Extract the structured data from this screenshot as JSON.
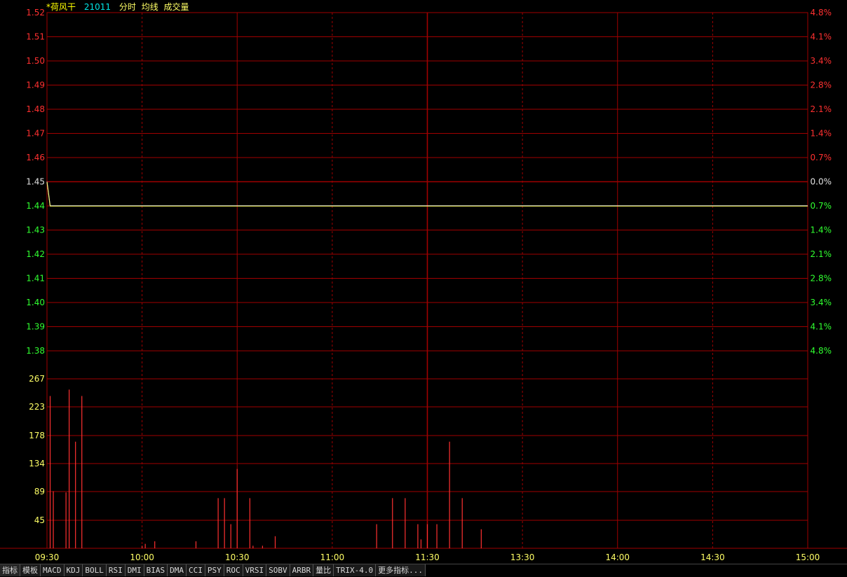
{
  "header": {
    "stock_name": "*荷风干",
    "stock_code": "21011",
    "legend_items": [
      "分时",
      "均线",
      "成交量"
    ],
    "colors": {
      "name": "#ffff00",
      "code": "#00e5e5",
      "legend": "#ffff66"
    }
  },
  "price_axis": {
    "labels": [
      "1.52",
      "1.51",
      "1.50",
      "1.49",
      "1.48",
      "1.47",
      "1.46",
      "1.45",
      "1.44",
      "1.43",
      "1.42",
      "1.41",
      "1.40",
      "1.39",
      "1.38"
    ],
    "colors": [
      "#ff3030",
      "#ff3030",
      "#ff3030",
      "#ff3030",
      "#ff3030",
      "#ff3030",
      "#ff3030",
      "#e0e0e0",
      "#30ff30",
      "#30ff30",
      "#30ff30",
      "#30ff30",
      "#30ff30",
      "#30ff30",
      "#30ff30"
    ]
  },
  "percent_axis": {
    "labels": [
      "4.8%",
      "4.1%",
      "3.4%",
      "2.8%",
      "2.1%",
      "1.4%",
      "0.7%",
      "0.0%",
      "0.7%",
      "1.4%",
      "2.1%",
      "2.8%",
      "3.4%",
      "4.1%",
      "4.8%"
    ],
    "colors": [
      "#ff3030",
      "#ff3030",
      "#ff3030",
      "#ff3030",
      "#ff3030",
      "#ff3030",
      "#ff3030",
      "#e0e0e0",
      "#30ff30",
      "#30ff30",
      "#30ff30",
      "#30ff30",
      "#30ff30",
      "#30ff30",
      "#30ff30"
    ]
  },
  "volume_axis": {
    "labels": [
      "267",
      "223",
      "178",
      "134",
      "89",
      "45"
    ],
    "color": "#ffff66"
  },
  "time_axis": {
    "labels": [
      "09:30",
      "10:00",
      "10:30",
      "11:00",
      "11:30",
      "13:30",
      "14:00",
      "14:30",
      "15:00"
    ],
    "color": "#ffff66"
  },
  "chart_data": {
    "type": "line",
    "title": "*荷风干 21011",
    "price_range": [
      1.38,
      1.52
    ],
    "volume_range": [
      0,
      267
    ],
    "price_series": {
      "name": "分时",
      "x": [
        "09:30",
        "09:31",
        "15:00"
      ],
      "y": [
        1.45,
        1.44,
        1.44
      ]
    },
    "volume_bars": [
      {
        "min": 1,
        "value": 240
      },
      {
        "min": 2,
        "value": 90
      },
      {
        "min": 6,
        "value": 88
      },
      {
        "min": 7,
        "value": 250
      },
      {
        "min": 9,
        "value": 168
      },
      {
        "min": 11,
        "value": 240
      },
      {
        "min": 30,
        "value": 4
      },
      {
        "min": 31,
        "value": 7
      },
      {
        "min": 34,
        "value": 11
      },
      {
        "min": 47,
        "value": 11
      },
      {
        "min": 54,
        "value": 79
      },
      {
        "min": 56,
        "value": 79
      },
      {
        "min": 58,
        "value": 38
      },
      {
        "min": 60,
        "value": 125
      },
      {
        "min": 64,
        "value": 79
      },
      {
        "min": 65,
        "value": 4
      },
      {
        "min": 68,
        "value": 4
      },
      {
        "min": 72,
        "value": 19
      },
      {
        "min": 104,
        "value": 38
      },
      {
        "min": 109,
        "value": 79
      },
      {
        "min": 113,
        "value": 79
      },
      {
        "min": 117,
        "value": 38
      },
      {
        "min": 118,
        "value": 14
      },
      {
        "min": 120,
        "value": 38
      },
      {
        "min": 123,
        "value": 38
      },
      {
        "min": 127,
        "value": 168
      },
      {
        "min": 131,
        "value": 79
      },
      {
        "min": 137,
        "value": 30
      }
    ],
    "grid": true
  },
  "bottom_tabs": [
    "指标",
    "模板",
    "MACD",
    "KDJ",
    "BOLL",
    "RSI",
    "DMI",
    "BIAS",
    "DMA",
    "CCI",
    "PSY",
    "ROC",
    "VRSI",
    "SOBV",
    "ARBR",
    "量比",
    "TRIX-4.0",
    "更多指标..."
  ],
  "colors": {
    "background": "#000000",
    "grid": "#a00000",
    "price_line": "#ffffff",
    "avg_line": "#ffff00",
    "volume_bar": "#ff3030"
  }
}
